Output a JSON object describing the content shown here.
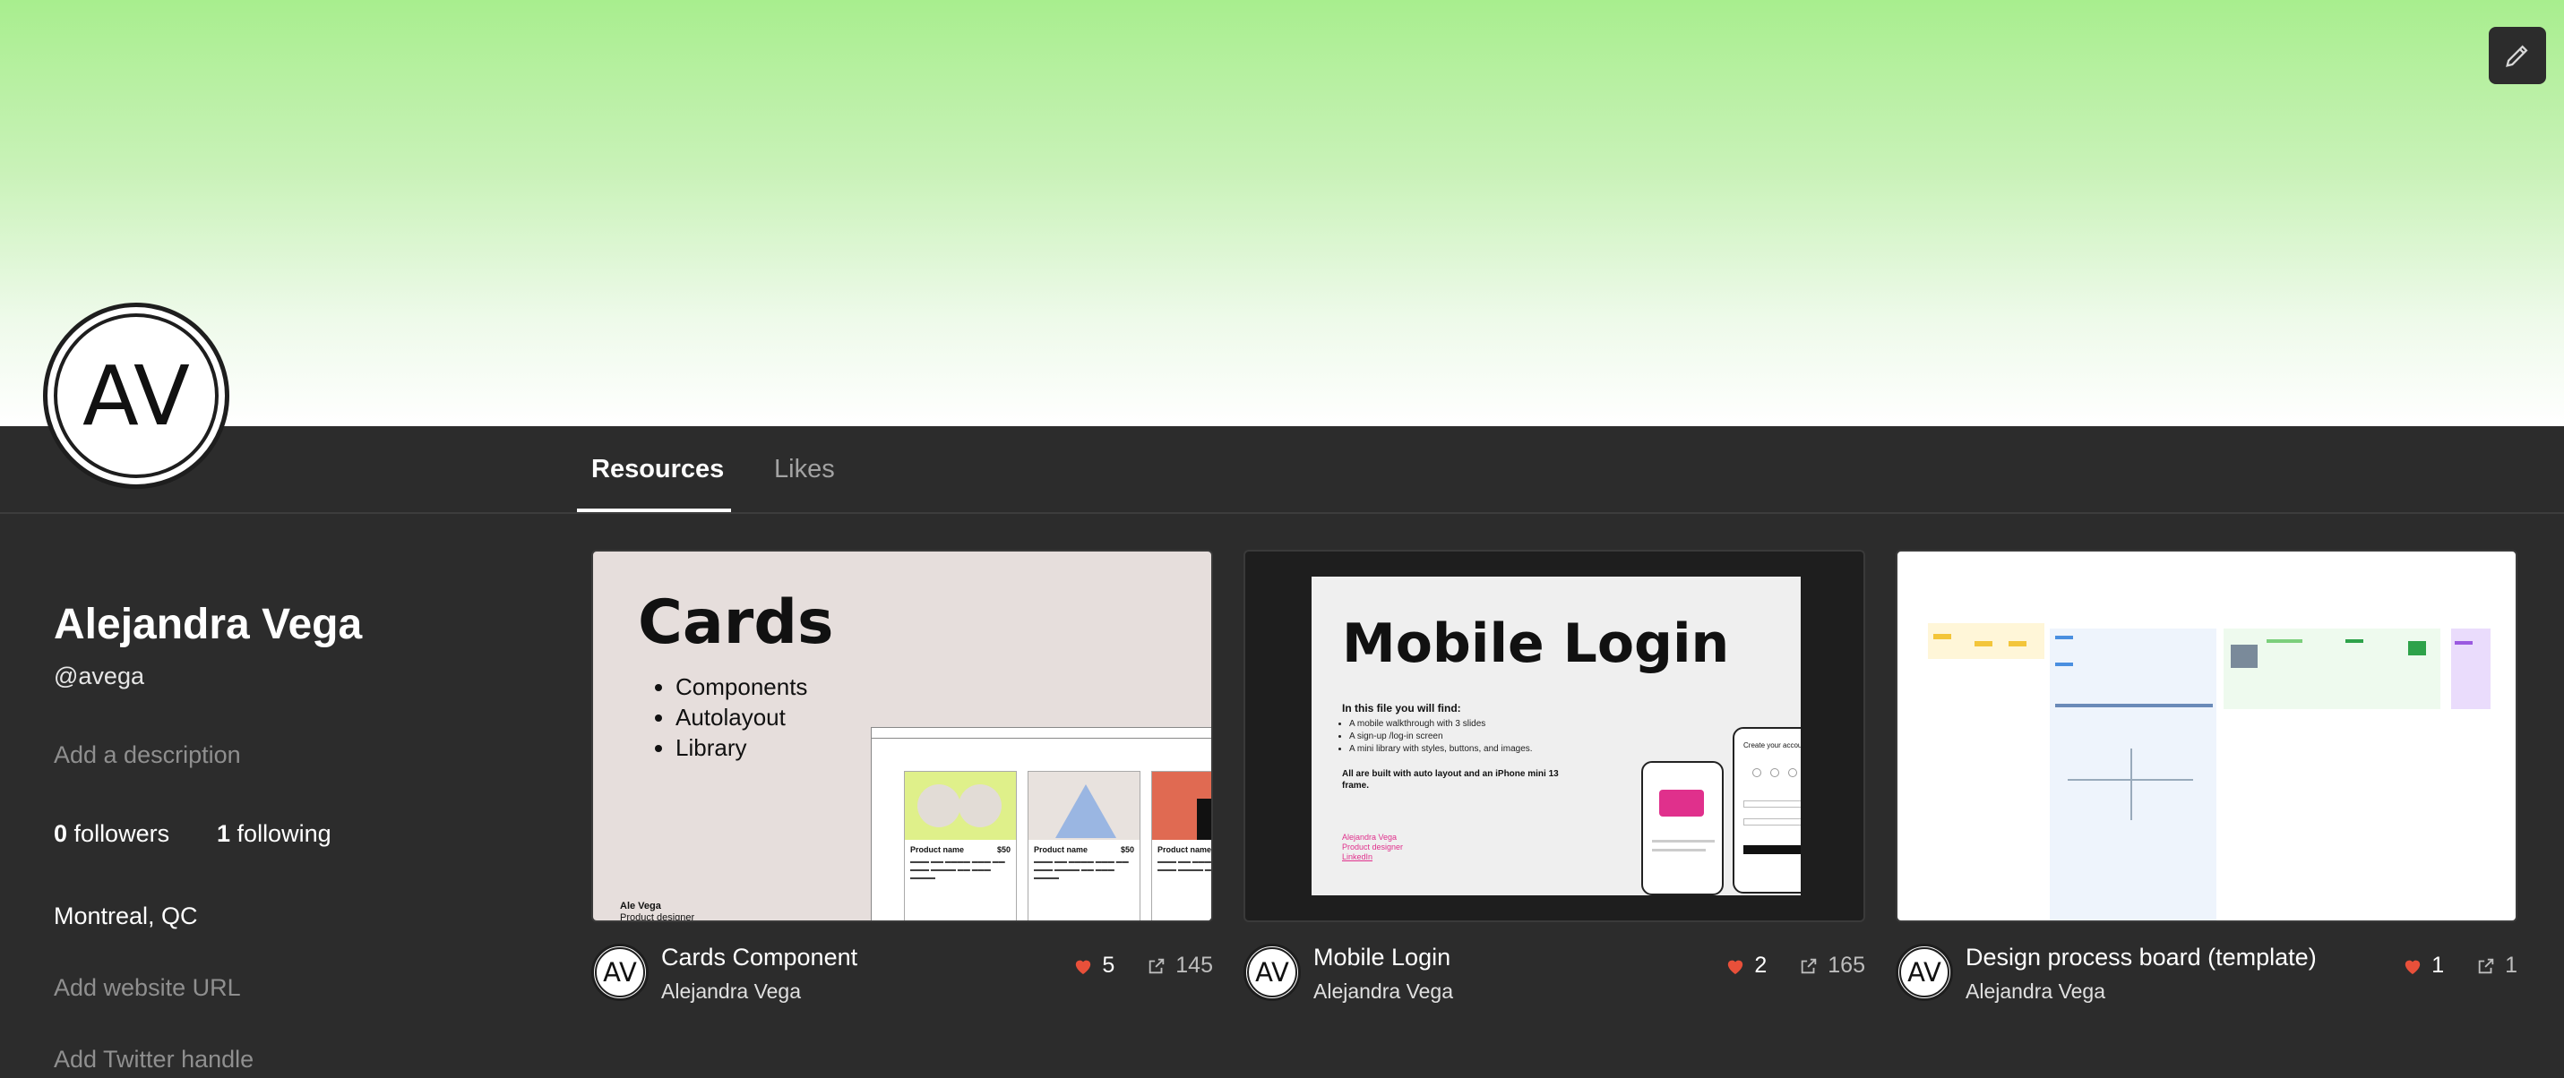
{
  "profile": {
    "initials": "AV",
    "name": "Alejandra Vega",
    "handle": "@avega",
    "description_placeholder": "Add a description",
    "followers_count": "0",
    "followers_label": "followers",
    "following_count": "1",
    "following_label": "following",
    "location": "Montreal, QC",
    "website_placeholder": "Add website URL",
    "twitter_placeholder": "Add Twitter handle"
  },
  "tabs": [
    {
      "label": "Resources",
      "active": true
    },
    {
      "label": "Likes",
      "active": false
    }
  ],
  "cards": [
    {
      "title": "Cards Component",
      "author": "Alejandra Vega",
      "likes": "5",
      "duplicates": "145",
      "thumb": {
        "heading": "Cards",
        "bullets": [
          "Components",
          "Autolayout",
          "Library"
        ],
        "sig_name": "Ale Vega",
        "sig_role": "Product designer",
        "products": [
          {
            "name": "Product name",
            "price": "$50"
          },
          {
            "name": "Product name",
            "price": "$50"
          },
          {
            "name": "Product name",
            "price": ""
          }
        ]
      }
    },
    {
      "title": "Mobile Login",
      "author": "Alejandra Vega",
      "likes": "2",
      "duplicates": "165",
      "thumb": {
        "heading": "Mobile Login",
        "sub": "In this file you will find:",
        "bullets": [
          "A mobile walkthrough with 3 slides",
          "A sign-up /log-in screen",
          "A mini library with styles, buttons, and images."
        ],
        "note": "All are built with auto layout and an iPhone mini 13 frame.",
        "pink1": "Alejandra Vega",
        "pink2": "Product designer",
        "pink3": "LinkedIn",
        "phone_title": "Create your account"
      }
    },
    {
      "title": "Design process board (template)",
      "author": "Alejandra Vega",
      "likes": "1",
      "duplicates": "1"
    }
  ],
  "colors": {
    "accent_heart": "#e8503a",
    "banner_top": "#a8ee8e",
    "background": "#2c2c2c"
  }
}
